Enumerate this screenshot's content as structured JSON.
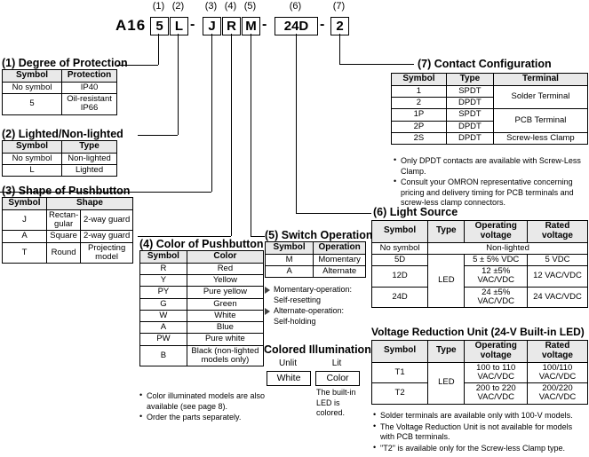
{
  "part_number": {
    "prefix": "A16",
    "segments": [
      {
        "num": "(1)",
        "value": "5",
        "boxed": true
      },
      {
        "num": "(2)",
        "value": "L",
        "boxed": true
      },
      {
        "num": "",
        "value": "-",
        "boxed": false
      },
      {
        "num": "(3)",
        "value": "J",
        "boxed": true
      },
      {
        "num": "(4)",
        "value": "R",
        "boxed": true
      },
      {
        "num": "(5)",
        "value": "M",
        "boxed": true
      },
      {
        "num": "",
        "value": "-",
        "boxed": false
      },
      {
        "num": "(6)",
        "value": "24D",
        "boxed": true
      },
      {
        "num": "",
        "value": "-",
        "boxed": false
      },
      {
        "num": "(7)",
        "value": "2",
        "boxed": true
      }
    ]
  },
  "degree_of_protection": {
    "title": "(1) Degree of Protection",
    "headers": [
      "Symbol",
      "Protection"
    ],
    "rows": [
      [
        "No symbol",
        "IP40"
      ],
      [
        "5",
        "Oil-resistant\nIP66"
      ]
    ]
  },
  "lighted": {
    "title": "(2) Lighted/Non-lighted",
    "headers": [
      "Symbol",
      "Type"
    ],
    "rows": [
      [
        "No symbol",
        "Non-lighted"
      ],
      [
        "L",
        "Lighted"
      ]
    ]
  },
  "shape": {
    "title": "(3) Shape of Pushbutton",
    "headers": [
      "Symbol",
      "Shape"
    ],
    "rows": [
      [
        "J",
        "Rectan-\ngular",
        "2-way guard"
      ],
      [
        "A",
        "Square",
        "2-way guard"
      ],
      [
        "T",
        "Round",
        "Projecting\nmodel"
      ]
    ]
  },
  "color": {
    "title": "(4) Color of Pushbutton",
    "headers": [
      "Symbol",
      "Color"
    ],
    "rows": [
      [
        "R",
        "Red"
      ],
      [
        "Y",
        "Yellow"
      ],
      [
        "PY",
        "Pure yellow"
      ],
      [
        "G",
        "Green"
      ],
      [
        "W",
        "White"
      ],
      [
        "A",
        "Blue"
      ],
      [
        "PW",
        "Pure white"
      ],
      [
        "B",
        "Black (non-lighted\nmodels only)"
      ]
    ],
    "notes": [
      "Color illuminated models are also available (see page 8).",
      "Order the parts separately."
    ]
  },
  "switch_operation": {
    "title": "(5) Switch Operation",
    "headers": [
      "Symbol",
      "Operation"
    ],
    "rows": [
      [
        "M",
        "Momentary"
      ],
      [
        "A",
        "Alternate"
      ]
    ],
    "notes": [
      {
        "head": "Momentary-operation:",
        "sub": "Self-resetting"
      },
      {
        "head": "Alternate-operation:",
        "sub": "Self-holding"
      }
    ]
  },
  "colored_illumination": {
    "title": "Colored Illumination",
    "unlit_label": "Unlit",
    "lit_label": "Lit",
    "unlit_value": "White",
    "lit_value": "Color",
    "note": "The built-in\nLED is colored."
  },
  "contact_configuration": {
    "title": "(7) Contact Configuration",
    "headers": [
      "Symbol",
      "Type",
      "Terminal"
    ],
    "rows": [
      {
        "symbol": "1",
        "type": "SPDT",
        "terminal": "Solder Terminal",
        "terminal_span": 2
      },
      {
        "symbol": "2",
        "type": "DPDT"
      },
      {
        "symbol": "1P",
        "type": "SPDT",
        "terminal": "PCB Terminal",
        "terminal_span": 2
      },
      {
        "symbol": "2P",
        "type": "DPDT"
      },
      {
        "symbol": "2S",
        "type": "DPDT",
        "terminal": "Screw-less Clamp",
        "terminal_span": 1
      }
    ],
    "notes": [
      "Only DPDT contacts are available with Screw-Less Clamp.",
      "Consult your OMRON representative concerning pricing and delivery timing for PCB terminals and screw-less clamp connectors."
    ]
  },
  "light_source": {
    "title": "(6) Light Source",
    "headers": [
      "Symbol",
      "Type",
      "Operating\nvoltage",
      "Rated\nvoltage"
    ],
    "nonlighted_symbol": "No symbol",
    "nonlighted_label": "Non-lighted",
    "led_label": "LED",
    "rows": [
      {
        "symbol": "5D",
        "operating": "5 ± 5% VDC",
        "rated": "5 VDC"
      },
      {
        "symbol": "12D",
        "operating": "12 ±5%\nVAC/VDC",
        "rated": "12 VAC/VDC"
      },
      {
        "symbol": "24D",
        "operating": "24 ±5%\nVAC/VDC",
        "rated": "24 VAC/VDC"
      }
    ]
  },
  "voltage_reduction": {
    "title": "Voltage Reduction Unit (24-V Built-in LED)",
    "headers": [
      "Symbol",
      "Type",
      "Operating\nvoltage",
      "Rated\nvoltage"
    ],
    "led_label": "LED",
    "rows": [
      {
        "symbol": "T1",
        "operating": "100 to 110\nVAC/VDC",
        "rated": "100/110\nVAC/VDC"
      },
      {
        "symbol": "T2",
        "operating": "200 to 220\nVAC/VDC",
        "rated": "200/220\nVAC/VDC"
      }
    ],
    "notes": [
      "Solder terminals are available only with 100-V models.",
      "The Voltage Reduction Unit is not available for models with PCB terminals.",
      "\"T2\" is available only for the Screw-less Clamp type."
    ]
  }
}
